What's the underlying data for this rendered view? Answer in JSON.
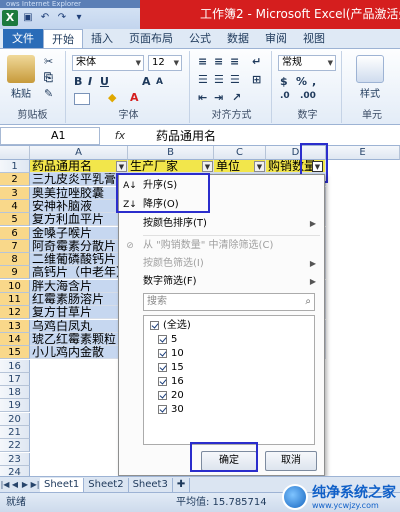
{
  "window": {
    "ie_strip": "ows Internet Explorer",
    "title": "工作簿2 - Microsoft Excel(产品激活失败)",
    "app_logo": "X"
  },
  "ribbon_tabs": [
    "文件",
    "开始",
    "插入",
    "页面布局",
    "公式",
    "数据",
    "审阅",
    "视图"
  ],
  "ribbon": {
    "paste": "粘贴",
    "clipboard": "剪贴板",
    "font_name": "宋体",
    "font_size": "12",
    "bold": "B",
    "italic": "I",
    "underline": "U",
    "grow_font": "A",
    "shrink_font": "A",
    "font_group": "字体",
    "align_group": "对齐方式",
    "number_format": "常规",
    "percent": "%",
    "comma": ",",
    "number_group": "数字",
    "style_label": "样式",
    "cells_label": "单元"
  },
  "formula_bar": {
    "name_box": "A1",
    "fx": "fx",
    "content": "药品通用名"
  },
  "columns": [
    "A",
    "B",
    "C",
    "D",
    "E"
  ],
  "rows": [
    "1",
    "2",
    "3",
    "4",
    "5",
    "6",
    "7",
    "8",
    "9",
    "10",
    "11",
    "12",
    "13",
    "14",
    "15",
    "16",
    "17",
    "18",
    "19",
    "20",
    "21",
    "22",
    "23",
    "24"
  ],
  "header_cells": [
    "药品通用名",
    "生产厂家",
    "单位",
    "购销数量"
  ],
  "data_cells": [
    "三九皮炎平乳膏",
    "奥美拉唑胶囊",
    "安神补脑液",
    "复方利血平片",
    "金嗓子喉片",
    "阿奇霉素分散片",
    "二维葡磷酸钙片",
    "高钙片（中老年）",
    "胖大海含片",
    "红霉素肠溶片",
    "复方甘草片",
    "乌鸡白凤丸",
    "琥乙红霉素颗粒",
    "小儿鸡内金散"
  ],
  "filter_menu": {
    "sort_asc": "升序(S)",
    "sort_desc": "降序(O)",
    "sort_color": "按颜色排序(T)",
    "clear_filter": "从 \"购销数量\" 中清除筛选(C)",
    "filter_color": "按颜色筛选(I)",
    "number_filter": "数字筛选(F)",
    "search_placeholder": "搜索",
    "values": [
      "(全选)",
      "5",
      "10",
      "15",
      "16",
      "20",
      "30"
    ],
    "ok": "确定",
    "cancel": "取消"
  },
  "sheets": [
    "Sheet1",
    "Sheet2",
    "Sheet3"
  ],
  "status": {
    "ready": "就绪",
    "average": "平均值: 15.785714"
  },
  "watermark": {
    "name": "纯净系统之家",
    "url": "www.ycwjzy.com"
  },
  "colors": {
    "title_red": "#d51e1e",
    "header_yellow": "#f2e64b",
    "selection_blue": "#c6d7f0",
    "highlight_frame": "#2b2dcc"
  }
}
